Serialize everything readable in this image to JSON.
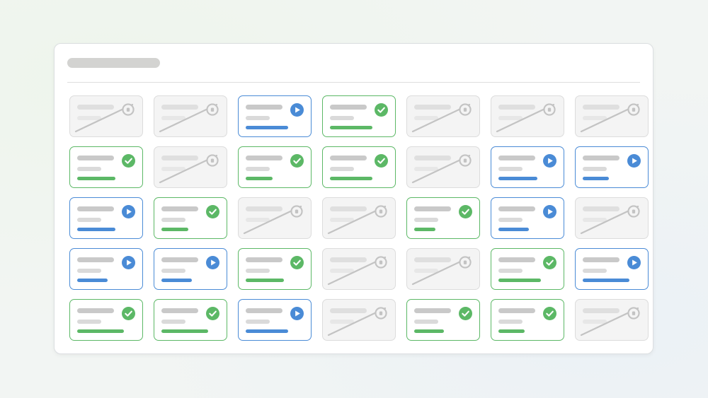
{
  "colors": {
    "completed": "#5cb866",
    "in_progress": "#4a8bd6",
    "locked": "#c3c3c3"
  },
  "icons": {
    "completed": "check-circle-icon",
    "in_progress": "play-circle-icon",
    "locked": "lock-circle-icon"
  },
  "grid": {
    "rows": 5,
    "columns": 7,
    "cards": [
      {
        "status": "locked",
        "progress": 0
      },
      {
        "status": "locked",
        "progress": 0
      },
      {
        "status": "in_progress",
        "progress": 0.72
      },
      {
        "status": "completed",
        "progress": 0.72
      },
      {
        "status": "locked",
        "progress": 0
      },
      {
        "status": "locked",
        "progress": 0
      },
      {
        "status": "locked",
        "progress": 0
      },
      {
        "status": "completed",
        "progress": 0.64
      },
      {
        "status": "locked",
        "progress": 0
      },
      {
        "status": "completed",
        "progress": 0.45
      },
      {
        "status": "completed",
        "progress": 0.72
      },
      {
        "status": "locked",
        "progress": 0
      },
      {
        "status": "in_progress",
        "progress": 0.66
      },
      {
        "status": "in_progress",
        "progress": 0.44
      },
      {
        "status": "in_progress",
        "progress": 0.64
      },
      {
        "status": "completed",
        "progress": 0.45
      },
      {
        "status": "locked",
        "progress": 0
      },
      {
        "status": "locked",
        "progress": 0
      },
      {
        "status": "completed",
        "progress": 0.36
      },
      {
        "status": "in_progress",
        "progress": 0.51
      },
      {
        "status": "locked",
        "progress": 0
      },
      {
        "status": "in_progress",
        "progress": 0.51
      },
      {
        "status": "in_progress",
        "progress": 0.51
      },
      {
        "status": "completed",
        "progress": 0.64
      },
      {
        "status": "locked",
        "progress": 0
      },
      {
        "status": "locked",
        "progress": 0
      },
      {
        "status": "completed",
        "progress": 0.72
      },
      {
        "status": "in_progress",
        "progress": 0.78
      },
      {
        "status": "completed",
        "progress": 0.78
      },
      {
        "status": "completed",
        "progress": 0.79
      },
      {
        "status": "in_progress",
        "progress": 0.71
      },
      {
        "status": "locked",
        "progress": 0
      },
      {
        "status": "completed",
        "progress": 0.5
      },
      {
        "status": "completed",
        "progress": 0.44
      },
      {
        "status": "locked",
        "progress": 0
      }
    ]
  }
}
